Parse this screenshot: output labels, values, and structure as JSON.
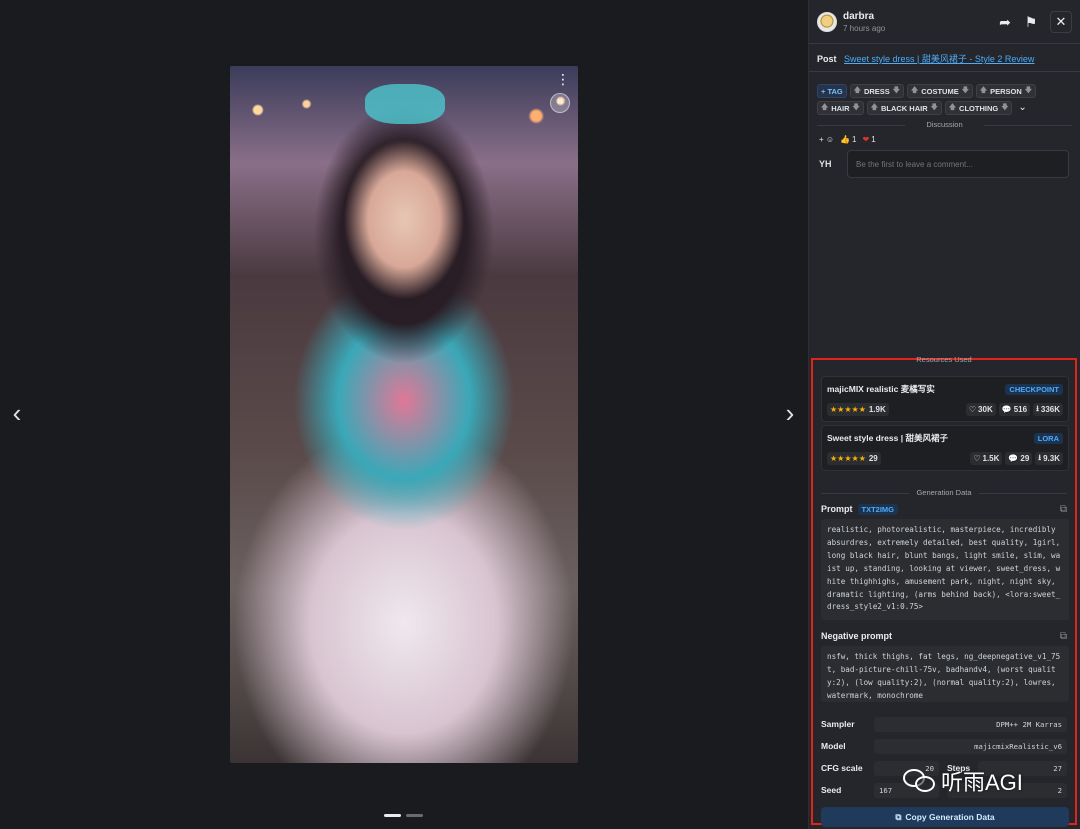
{
  "viewer": {
    "prev_label": "‹",
    "next_label": "›",
    "image_menu": "⋮",
    "scan_icon": "⌗"
  },
  "header": {
    "author": "darbra",
    "time": "7 hours ago",
    "share_icon": "➦",
    "flag_icon": "⚑",
    "close_icon": "✕"
  },
  "post": {
    "label": "Post",
    "link": "Sweet style dress | 甜美风裙子 - Style 2 Review"
  },
  "tags": {
    "add_label": "+ TAG",
    "items": [
      "DRESS",
      "COSTUME",
      "PERSON",
      "HAIR",
      "BLACK HAIR",
      "CLOTHING"
    ],
    "expand_icon": "⌄"
  },
  "discussion": {
    "label": "Discussion",
    "add_reaction": "+ ☺",
    "reactions": [
      {
        "emoji": "👍",
        "count": "1"
      },
      {
        "emoji": "❤",
        "count": "1"
      }
    ],
    "user_initials": "YH",
    "comment_placeholder": "Be the first to leave a comment..."
  },
  "resources": {
    "label": "Resources Used",
    "items": [
      {
        "name": "majicMIX realistic 麦橘写实",
        "type": "CHECKPOINT",
        "stars": "★★★★★",
        "rating": "1.9K",
        "likes": "30K",
        "comments": "516",
        "downloads": "336K"
      },
      {
        "name": "Sweet style dress | 甜美风裙子",
        "type": "LORA",
        "stars": "★★★★★",
        "rating": "29",
        "likes": "1.5K",
        "comments": "29",
        "downloads": "9.3K"
      }
    ]
  },
  "generation": {
    "label": "Generation Data",
    "prompt_title": "Prompt",
    "prompt_badge": "TXT2IMG",
    "prompt": "realistic, photorealistic, masterpiece, incredibly absurdres, extremely detailed, best quality, 1girl, long black hair, blunt bangs, light smile, slim, waist up, standing, looking at viewer, sweet_dress, white thighhighs, amusement park, night, night sky, dramatic lighting, (arms behind back), <lora:sweet_dress_style2_v1:0.75>",
    "negative_title": "Negative prompt",
    "negative": "nsfw, thick thighs, fat legs, ng_deepnegative_v1_75t, bad-picture-chill-75v, badhandv4, (worst quality:2), (low quality:2), (normal quality:2), lowres, watermark, monochrome",
    "sampler_label": "Sampler",
    "sampler": "DPM++ 2M Karras",
    "model_label": "Model",
    "model": "majicmixRealistic_v6",
    "cfg_label": "CFG scale",
    "cfg": "20",
    "steps_label": "Steps",
    "steps": "27",
    "seed_label": "Seed",
    "seed": "167",
    "clip_value": "2",
    "copy_label": "Copy Generation Data"
  },
  "watermark": {
    "text": "听雨AGI"
  },
  "colors": {
    "accent": "#4dabf7",
    "highlight_border": "#e0241b",
    "star": "#fab005"
  }
}
